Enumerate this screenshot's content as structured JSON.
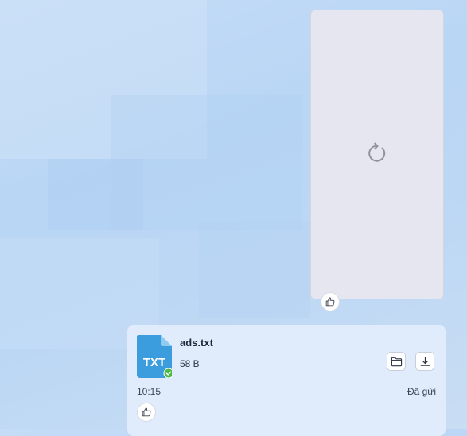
{
  "image_message": {
    "state": "loading",
    "loading_icon": "refresh-icon",
    "reaction_icon": "thumbs-up-icon"
  },
  "file_message": {
    "file_type": "TXT",
    "file_name": "ads.txt",
    "file_size": "58 B",
    "time": "10:15",
    "status": "Đã gửi",
    "file_icon_color": "#3b9ddd",
    "check_badge_color": "#4cb944",
    "actions": [
      {
        "name": "open-folder",
        "icon": "folder-icon"
      },
      {
        "name": "download",
        "icon": "download-icon"
      }
    ],
    "reaction_icon": "thumbs-up-icon"
  }
}
